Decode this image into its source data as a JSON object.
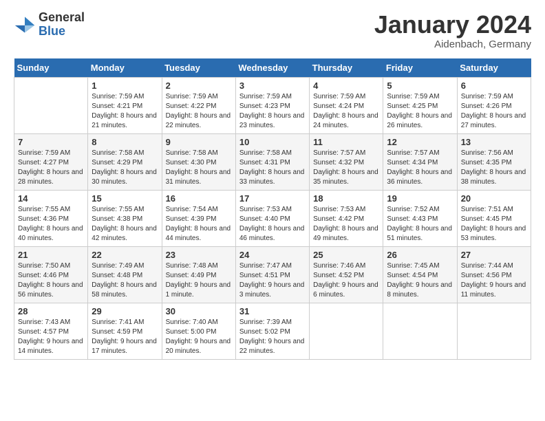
{
  "header": {
    "logo_general": "General",
    "logo_blue": "Blue",
    "month": "January 2024",
    "location": "Aidenbach, Germany"
  },
  "days_of_week": [
    "Sunday",
    "Monday",
    "Tuesday",
    "Wednesday",
    "Thursday",
    "Friday",
    "Saturday"
  ],
  "weeks": [
    {
      "days": [
        {
          "num": "",
          "sunrise": "",
          "sunset": "",
          "daylight": ""
        },
        {
          "num": "1",
          "sunrise": "Sunrise: 7:59 AM",
          "sunset": "Sunset: 4:21 PM",
          "daylight": "Daylight: 8 hours and 21 minutes."
        },
        {
          "num": "2",
          "sunrise": "Sunrise: 7:59 AM",
          "sunset": "Sunset: 4:22 PM",
          "daylight": "Daylight: 8 hours and 22 minutes."
        },
        {
          "num": "3",
          "sunrise": "Sunrise: 7:59 AM",
          "sunset": "Sunset: 4:23 PM",
          "daylight": "Daylight: 8 hours and 23 minutes."
        },
        {
          "num": "4",
          "sunrise": "Sunrise: 7:59 AM",
          "sunset": "Sunset: 4:24 PM",
          "daylight": "Daylight: 8 hours and 24 minutes."
        },
        {
          "num": "5",
          "sunrise": "Sunrise: 7:59 AM",
          "sunset": "Sunset: 4:25 PM",
          "daylight": "Daylight: 8 hours and 26 minutes."
        },
        {
          "num": "6",
          "sunrise": "Sunrise: 7:59 AM",
          "sunset": "Sunset: 4:26 PM",
          "daylight": "Daylight: 8 hours and 27 minutes."
        }
      ]
    },
    {
      "days": [
        {
          "num": "7",
          "sunrise": "Sunrise: 7:59 AM",
          "sunset": "Sunset: 4:27 PM",
          "daylight": "Daylight: 8 hours and 28 minutes."
        },
        {
          "num": "8",
          "sunrise": "Sunrise: 7:58 AM",
          "sunset": "Sunset: 4:29 PM",
          "daylight": "Daylight: 8 hours and 30 minutes."
        },
        {
          "num": "9",
          "sunrise": "Sunrise: 7:58 AM",
          "sunset": "Sunset: 4:30 PM",
          "daylight": "Daylight: 8 hours and 31 minutes."
        },
        {
          "num": "10",
          "sunrise": "Sunrise: 7:58 AM",
          "sunset": "Sunset: 4:31 PM",
          "daylight": "Daylight: 8 hours and 33 minutes."
        },
        {
          "num": "11",
          "sunrise": "Sunrise: 7:57 AM",
          "sunset": "Sunset: 4:32 PM",
          "daylight": "Daylight: 8 hours and 35 minutes."
        },
        {
          "num": "12",
          "sunrise": "Sunrise: 7:57 AM",
          "sunset": "Sunset: 4:34 PM",
          "daylight": "Daylight: 8 hours and 36 minutes."
        },
        {
          "num": "13",
          "sunrise": "Sunrise: 7:56 AM",
          "sunset": "Sunset: 4:35 PM",
          "daylight": "Daylight: 8 hours and 38 minutes."
        }
      ]
    },
    {
      "days": [
        {
          "num": "14",
          "sunrise": "Sunrise: 7:55 AM",
          "sunset": "Sunset: 4:36 PM",
          "daylight": "Daylight: 8 hours and 40 minutes."
        },
        {
          "num": "15",
          "sunrise": "Sunrise: 7:55 AM",
          "sunset": "Sunset: 4:38 PM",
          "daylight": "Daylight: 8 hours and 42 minutes."
        },
        {
          "num": "16",
          "sunrise": "Sunrise: 7:54 AM",
          "sunset": "Sunset: 4:39 PM",
          "daylight": "Daylight: 8 hours and 44 minutes."
        },
        {
          "num": "17",
          "sunrise": "Sunrise: 7:53 AM",
          "sunset": "Sunset: 4:40 PM",
          "daylight": "Daylight: 8 hours and 46 minutes."
        },
        {
          "num": "18",
          "sunrise": "Sunrise: 7:53 AM",
          "sunset": "Sunset: 4:42 PM",
          "daylight": "Daylight: 8 hours and 49 minutes."
        },
        {
          "num": "19",
          "sunrise": "Sunrise: 7:52 AM",
          "sunset": "Sunset: 4:43 PM",
          "daylight": "Daylight: 8 hours and 51 minutes."
        },
        {
          "num": "20",
          "sunrise": "Sunrise: 7:51 AM",
          "sunset": "Sunset: 4:45 PM",
          "daylight": "Daylight: 8 hours and 53 minutes."
        }
      ]
    },
    {
      "days": [
        {
          "num": "21",
          "sunrise": "Sunrise: 7:50 AM",
          "sunset": "Sunset: 4:46 PM",
          "daylight": "Daylight: 8 hours and 56 minutes."
        },
        {
          "num": "22",
          "sunrise": "Sunrise: 7:49 AM",
          "sunset": "Sunset: 4:48 PM",
          "daylight": "Daylight: 8 hours and 58 minutes."
        },
        {
          "num": "23",
          "sunrise": "Sunrise: 7:48 AM",
          "sunset": "Sunset: 4:49 PM",
          "daylight": "Daylight: 9 hours and 1 minute."
        },
        {
          "num": "24",
          "sunrise": "Sunrise: 7:47 AM",
          "sunset": "Sunset: 4:51 PM",
          "daylight": "Daylight: 9 hours and 3 minutes."
        },
        {
          "num": "25",
          "sunrise": "Sunrise: 7:46 AM",
          "sunset": "Sunset: 4:52 PM",
          "daylight": "Daylight: 9 hours and 6 minutes."
        },
        {
          "num": "26",
          "sunrise": "Sunrise: 7:45 AM",
          "sunset": "Sunset: 4:54 PM",
          "daylight": "Daylight: 9 hours and 8 minutes."
        },
        {
          "num": "27",
          "sunrise": "Sunrise: 7:44 AM",
          "sunset": "Sunset: 4:56 PM",
          "daylight": "Daylight: 9 hours and 11 minutes."
        }
      ]
    },
    {
      "days": [
        {
          "num": "28",
          "sunrise": "Sunrise: 7:43 AM",
          "sunset": "Sunset: 4:57 PM",
          "daylight": "Daylight: 9 hours and 14 minutes."
        },
        {
          "num": "29",
          "sunrise": "Sunrise: 7:41 AM",
          "sunset": "Sunset: 4:59 PM",
          "daylight": "Daylight: 9 hours and 17 minutes."
        },
        {
          "num": "30",
          "sunrise": "Sunrise: 7:40 AM",
          "sunset": "Sunset: 5:00 PM",
          "daylight": "Daylight: 9 hours and 20 minutes."
        },
        {
          "num": "31",
          "sunrise": "Sunrise: 7:39 AM",
          "sunset": "Sunset: 5:02 PM",
          "daylight": "Daylight: 9 hours and 22 minutes."
        },
        {
          "num": "",
          "sunrise": "",
          "sunset": "",
          "daylight": ""
        },
        {
          "num": "",
          "sunrise": "",
          "sunset": "",
          "daylight": ""
        },
        {
          "num": "",
          "sunrise": "",
          "sunset": "",
          "daylight": ""
        }
      ]
    }
  ]
}
